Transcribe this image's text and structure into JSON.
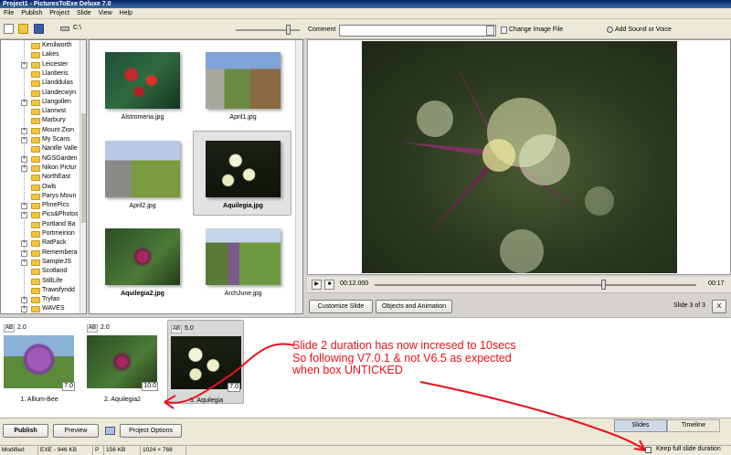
{
  "window": {
    "title": "Project1 - PicturesToExe Deluxe 7.0"
  },
  "menu": [
    "File",
    "Publish",
    "Project",
    "Slide",
    "View",
    "Help"
  ],
  "toolbar": {
    "drive": "C:\\",
    "comment_label": "Comment",
    "comment_value": "",
    "change_image": "Change Image File",
    "add_sound": "Add Sound or Voice"
  },
  "tree": [
    "Kenilworth",
    "Lakes",
    "Leicester",
    "Llanberis",
    "Llanddulas",
    "Llandecwyn",
    "Llangollen",
    "Llanrwst",
    "Marbury",
    "Mount Zion",
    "My Scans",
    "Nantlle Valle",
    "NGSGarden",
    "Nikon Pictur",
    "NorthEast",
    "Owls",
    "Parys Moun",
    "PhnePics",
    "Pics&Photos",
    "Portland Ba",
    "Portmeirion",
    "RatPack",
    "Remembera",
    "SampleJS",
    "Scotland",
    "StillLife",
    "Trawsfyndd",
    "Tryfan",
    "WAVES"
  ],
  "files": [
    {
      "name": "Alstromeria.jpg",
      "selected": false,
      "bold": false
    },
    {
      "name": "April1.jpg",
      "selected": false,
      "bold": false
    },
    {
      "name": "April2.jpg",
      "selected": false,
      "bold": false
    },
    {
      "name": "Aquilegia.jpg",
      "selected": true,
      "bold": true
    },
    {
      "name": "Aquilegia2.jpg",
      "selected": false,
      "bold": true
    },
    {
      "name": "ArchJune.jpg",
      "selected": false,
      "bold": false
    }
  ],
  "player": {
    "current_time": "00:12.000",
    "end_time": "00:17",
    "position": 0.71
  },
  "buttons": {
    "customize_slide": "Customize Slide",
    "objects_animation": "Objects and Animation",
    "close": "X",
    "publish": "Publish",
    "preview": "Preview",
    "project_options": "Project Options"
  },
  "slide_counter": "Slide 3 of 3",
  "slides": [
    {
      "ab": "AB",
      "transition": "",
      "duration": "7.0",
      "caption": "1. Allium-Bee",
      "selected": false
    },
    {
      "ab": "AB",
      "transition": "2.0",
      "duration": "10.0",
      "caption": "2. Aquilegia2",
      "selected": false
    },
    {
      "ab": "AB",
      "transition": "5.0",
      "duration": "7.0",
      "caption": "3. Aquilegia",
      "selected": true
    }
  ],
  "first_slide_transition": "2.0",
  "annotation": [
    "Slide 2 duration has now incresed to 10secs",
    "So following V7.0.1 & not V6.5 as expected",
    "when box UNTICKED"
  ],
  "tabs": {
    "slides": "Slides",
    "timeline": "Timeline"
  },
  "status": {
    "state": "Modified",
    "exe": "EXE - 946 KB",
    "p": "P",
    "kb": "156 KB",
    "res": "1024 × 768"
  },
  "keep_full": {
    "label": "Keep full slide duration",
    "checked": false
  },
  "colors": {
    "annotation": "#e8121a",
    "titlebar": "#0a246a"
  }
}
